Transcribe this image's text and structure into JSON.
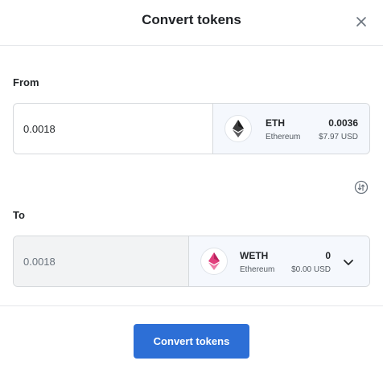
{
  "header": {
    "title": "Convert tokens",
    "close_icon": "close-icon"
  },
  "from": {
    "label": "From",
    "amount": "0.0018",
    "token": {
      "symbol": "ETH",
      "network": "Ethereum",
      "balance": "0.0036",
      "usd": "$7.97 USD",
      "icon": "ethereum-icon",
      "icon_color": "#3c3c3d"
    }
  },
  "swap": {
    "icon": "swap-direction-icon"
  },
  "to": {
    "label": "To",
    "amount": "0.0018",
    "token": {
      "symbol": "WETH",
      "network": "Ethereum",
      "balance": "0",
      "usd": "$0.00 USD",
      "icon": "weth-icon",
      "icon_color": "#e2407d"
    },
    "dropdown_icon": "chevron-down-icon"
  },
  "footer": {
    "button_label": "Convert tokens",
    "button_color": "#2d6fd6"
  }
}
